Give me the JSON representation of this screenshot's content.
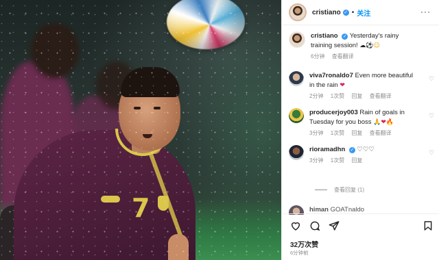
{
  "post": {
    "username": "cristiano",
    "verified": true,
    "dot": "•",
    "follow_label": "关注",
    "more_label": "···",
    "caption": {
      "username": "cristiano",
      "text": "Yesterday's rainy training session! ",
      "emojis": [
        "cloud-rain-emoji",
        "soccer-ball-emoji",
        "grinning-emoji"
      ],
      "time": "6分钟",
      "translate": "查看翻译"
    },
    "likes": "32万次赞",
    "ago": "6分钟前"
  },
  "comments": [
    {
      "username": "viva7ronaldo7",
      "text": "Even more beautiful in the rain",
      "emoji": "red-heart-emoji",
      "time": "2分钟",
      "likes": "1次赞",
      "reply": "回复",
      "translate": "查看翻译"
    },
    {
      "username": "producerjoy003",
      "text": "Rain of goals in Tuesday for you boss",
      "emoji": "pray-heart-fire-emoji",
      "time": "3分钟",
      "likes": "1次赞",
      "reply": "回复",
      "translate": "查看翻译"
    },
    {
      "username": "rioramadhn",
      "verified": true,
      "text": "♡♡♡",
      "time": "3分钟",
      "likes": "1次赞",
      "reply": "回复"
    }
  ],
  "view_replies": "查看回复 (1)",
  "partial_comment": {
    "username": "himan",
    "text": "GOATnaldo"
  },
  "icons": {
    "like": "heart-icon",
    "comment": "comment-icon",
    "share": "share-icon",
    "save": "bookmark-icon"
  },
  "colors": {
    "link_blue": "#0095f6",
    "verified_blue": "#3897f0",
    "heart_red": "#e0245e",
    "jersey_purple": "#5d2546",
    "jersey_yellow": "#d9c64a"
  }
}
